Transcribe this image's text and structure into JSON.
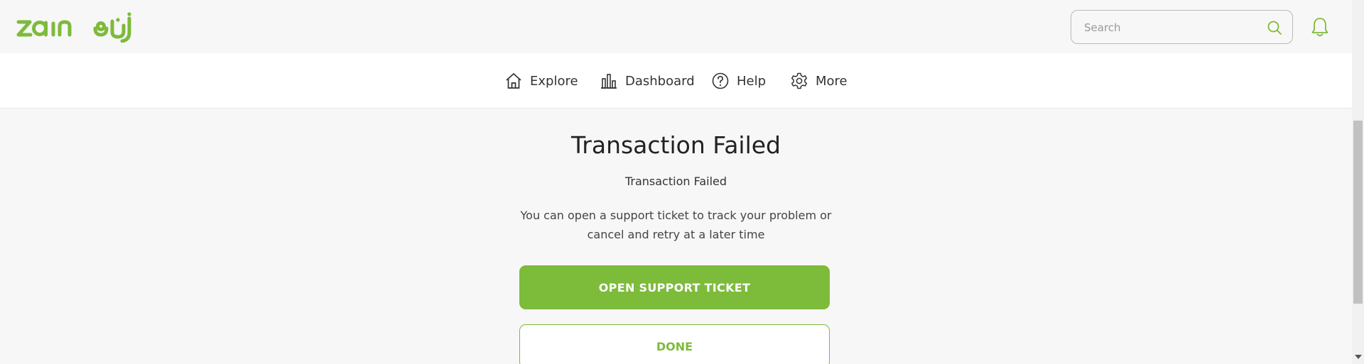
{
  "brand": {
    "name": "zain",
    "accent_color": "#7dbb3a"
  },
  "header": {
    "logo_icon": "zain-logo",
    "search": {
      "placeholder": "Search",
      "value": "",
      "icon": "search-icon"
    },
    "notifications_icon": "bell-icon"
  },
  "nav": {
    "items": [
      {
        "label": "Explore",
        "icon": "home-icon"
      },
      {
        "label": "Dashboard",
        "icon": "bar-chart-icon"
      },
      {
        "label": "Help",
        "icon": "question-icon"
      },
      {
        "label": "More",
        "icon": "gear-icon"
      }
    ]
  },
  "main": {
    "title": "Transaction Failed",
    "subtitle": "Transaction Failed",
    "message": "You can open a support ticket to track your problem or cancel and retry at a later time",
    "primary_button": "OPEN SUPPORT TICKET",
    "secondary_button": "DONE"
  }
}
